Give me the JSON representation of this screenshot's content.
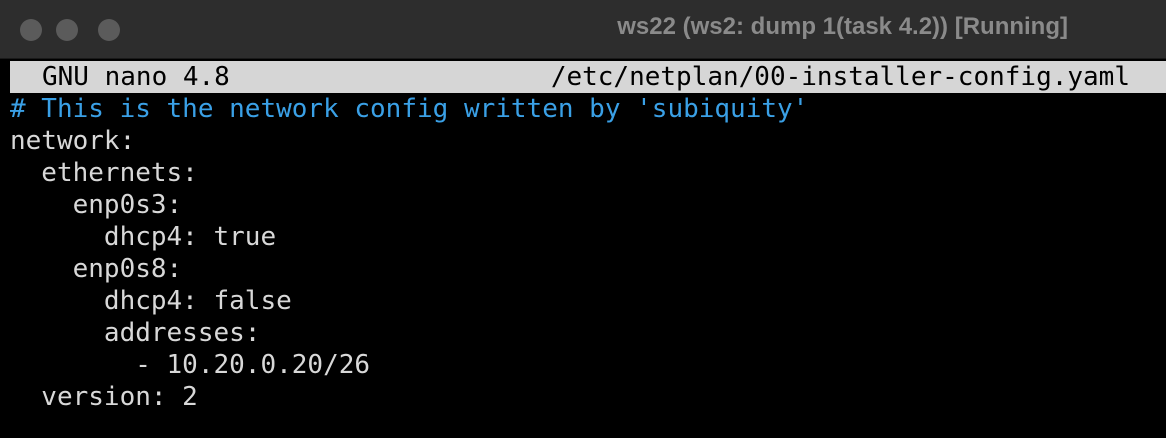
{
  "window": {
    "title": "ws22 (ws2: dump 1(task 4.2)) [Running]"
  },
  "nano": {
    "app_version": "GNU nano 4.8",
    "filename": "/etc/netplan/00-installer-config.yaml"
  },
  "lines": [
    "# This is the network config written by 'subiquity'",
    "network:",
    "  ethernets:",
    "    enp0s3:",
    "      dhcp4: true",
    "    enp0s8:",
    "      dhcp4: false",
    "      addresses:",
    "        - 10.20.0.20/26",
    "  version: 2"
  ],
  "colors": {
    "comment": "#3aa0e6",
    "text": "#d8d8d8",
    "header_bg": "#d6d6d6"
  }
}
